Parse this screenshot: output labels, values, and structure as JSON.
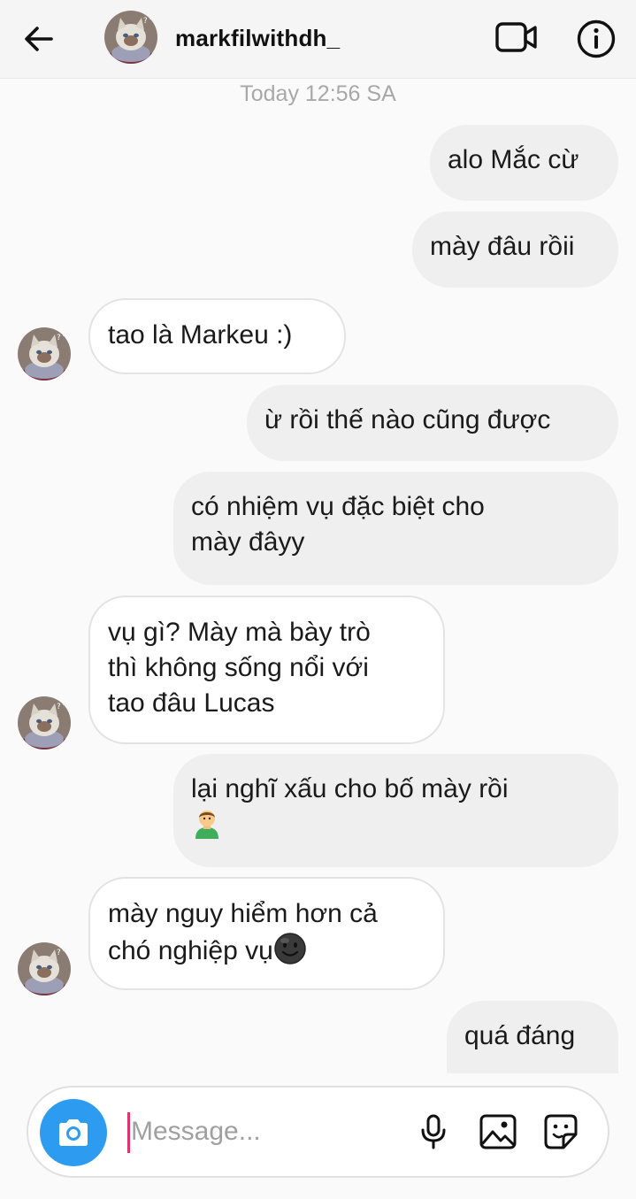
{
  "header": {
    "username": "markfilwithdh_",
    "back_icon": "arrow-left-icon",
    "video_icon": "video-camera-icon",
    "info_icon": "info-circle-icon"
  },
  "conversation": {
    "timestamp": "Today 12:56 SA",
    "messages": [
      {
        "sender": "me",
        "text": "alo Mắc cừ"
      },
      {
        "sender": "me",
        "text": "mày đâu rồii"
      },
      {
        "sender": "them",
        "text": "tao là Markeu :)"
      },
      {
        "sender": "me",
        "text": "ừ rồi thế nào cũng được"
      },
      {
        "sender": "me",
        "lines": [
          "có nhiệm vụ đặc biệt cho",
          "mày đâyy"
        ]
      },
      {
        "sender": "them",
        "lines": [
          "vụ gì? Mày mà bày trò",
          "thì không sống nổi với",
          "tao đâu Lucas"
        ]
      },
      {
        "sender": "me",
        "lines": [
          "lại nghĩ xấu cho bố mày rồi"
        ],
        "emoji": "person-emoji"
      },
      {
        "sender": "them",
        "lines": [
          "mày nguy hiểm hơn cả",
          "chó nghiệp vụ"
        ],
        "emoji": "dark-face-emoji"
      },
      {
        "sender": "me",
        "text": "quá đáng"
      }
    ]
  },
  "composer": {
    "placeholder": "Message...",
    "value": "",
    "camera_icon": "camera-icon",
    "mic_icon": "microphone-icon",
    "gallery_icon": "image-gallery-icon",
    "sticker_icon": "sticker-icon"
  },
  "colors": {
    "sent_bubble": "#efefef",
    "received_bubble": "#ffffff",
    "camera_button": "#2d9cf0",
    "cursor": "#e1306c",
    "timestamp": "#a8a8a8"
  }
}
